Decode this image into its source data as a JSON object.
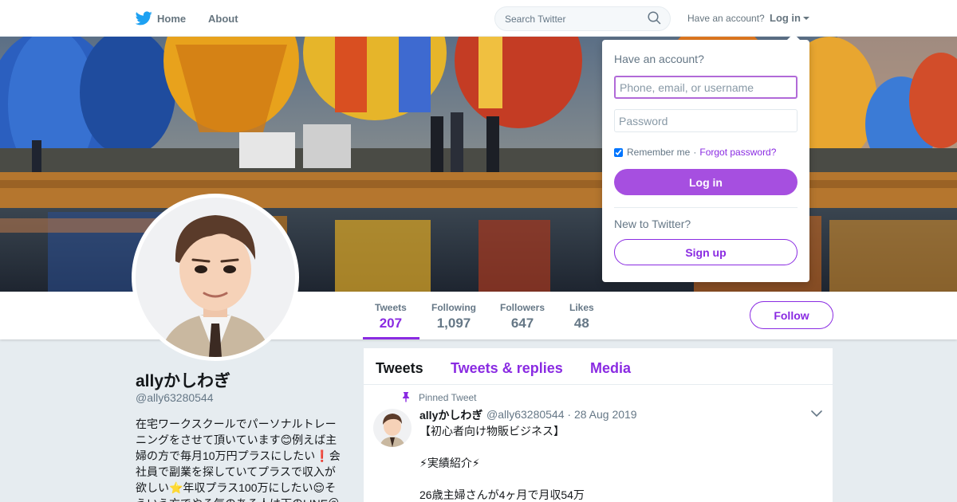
{
  "nav": {
    "home_label": "Home",
    "about_label": "About",
    "search_placeholder": "Search Twitter",
    "have_account": "Have an account?",
    "login_label": "Log in"
  },
  "profile": {
    "name": "allyかしわぎ",
    "handle": "@ally63280544",
    "bio": "在宅ワークスクールでパーソナルトレーニングをさせて頂いています😊例えば主婦の方で毎月10万円プラスにしたい❗会社員で副業を探していてプラスで収入が欲しい⭐年収プラス100万にしたい😌そういう方でやる気のある人は下のLINE＠",
    "follow_label": "Follow"
  },
  "stats": [
    {
      "label": "Tweets",
      "value": "207"
    },
    {
      "label": "Following",
      "value": "1,097"
    },
    {
      "label": "Followers",
      "value": "647"
    },
    {
      "label": "Likes",
      "value": "48"
    }
  ],
  "timeline": {
    "tabs": [
      "Tweets",
      "Tweets & replies",
      "Media"
    ],
    "pinned_label": "Pinned Tweet",
    "tweet": {
      "name": "allyかしわぎ",
      "meta": "@ally63280544 · 28 Aug 2019",
      "lines": [
        "【初心者向け物販ビジネス】",
        "",
        "⚡実績紹介⚡",
        "",
        "26歳主婦さんが4ヶ月で月収54万"
      ]
    }
  },
  "login_dropdown": {
    "title": "Have an account?",
    "username_placeholder": "Phone, email, or username",
    "password_placeholder": "Password",
    "remember_label": "Remember me",
    "separator": "·",
    "forgot_label": "Forgot password?",
    "login_button": "Log in",
    "new_label": "New to Twitter?",
    "signup_button": "Sign up"
  },
  "colors": {
    "accent": "#8a2be2",
    "login_button": "#a64fe0",
    "twitter_blue": "#1da1f2"
  }
}
